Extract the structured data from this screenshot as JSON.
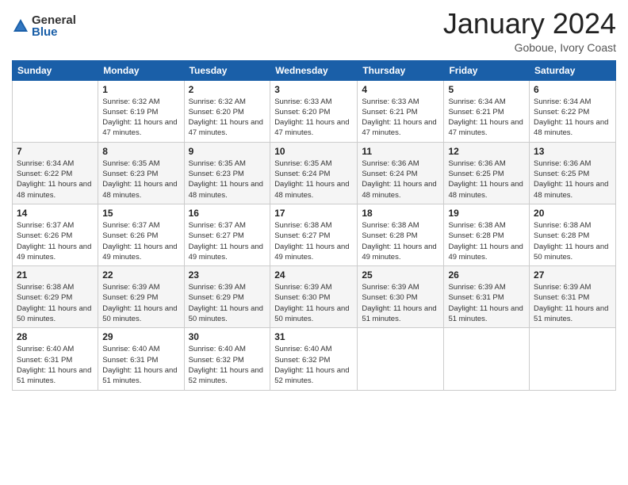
{
  "header": {
    "logo_general": "General",
    "logo_blue": "Blue",
    "month_title": "January 2024",
    "subtitle": "Goboue, Ivory Coast"
  },
  "days_of_week": [
    "Sunday",
    "Monday",
    "Tuesday",
    "Wednesday",
    "Thursday",
    "Friday",
    "Saturday"
  ],
  "weeks": [
    [
      {
        "day": "",
        "sunrise": "",
        "sunset": "",
        "daylight": ""
      },
      {
        "day": "1",
        "sunrise": "Sunrise: 6:32 AM",
        "sunset": "Sunset: 6:19 PM",
        "daylight": "Daylight: 11 hours and 47 minutes."
      },
      {
        "day": "2",
        "sunrise": "Sunrise: 6:32 AM",
        "sunset": "Sunset: 6:20 PM",
        "daylight": "Daylight: 11 hours and 47 minutes."
      },
      {
        "day": "3",
        "sunrise": "Sunrise: 6:33 AM",
        "sunset": "Sunset: 6:20 PM",
        "daylight": "Daylight: 11 hours and 47 minutes."
      },
      {
        "day": "4",
        "sunrise": "Sunrise: 6:33 AM",
        "sunset": "Sunset: 6:21 PM",
        "daylight": "Daylight: 11 hours and 47 minutes."
      },
      {
        "day": "5",
        "sunrise": "Sunrise: 6:34 AM",
        "sunset": "Sunset: 6:21 PM",
        "daylight": "Daylight: 11 hours and 47 minutes."
      },
      {
        "day": "6",
        "sunrise": "Sunrise: 6:34 AM",
        "sunset": "Sunset: 6:22 PM",
        "daylight": "Daylight: 11 hours and 48 minutes."
      }
    ],
    [
      {
        "day": "7",
        "sunrise": "Sunrise: 6:34 AM",
        "sunset": "Sunset: 6:22 PM",
        "daylight": "Daylight: 11 hours and 48 minutes."
      },
      {
        "day": "8",
        "sunrise": "Sunrise: 6:35 AM",
        "sunset": "Sunset: 6:23 PM",
        "daylight": "Daylight: 11 hours and 48 minutes."
      },
      {
        "day": "9",
        "sunrise": "Sunrise: 6:35 AM",
        "sunset": "Sunset: 6:23 PM",
        "daylight": "Daylight: 11 hours and 48 minutes."
      },
      {
        "day": "10",
        "sunrise": "Sunrise: 6:35 AM",
        "sunset": "Sunset: 6:24 PM",
        "daylight": "Daylight: 11 hours and 48 minutes."
      },
      {
        "day": "11",
        "sunrise": "Sunrise: 6:36 AM",
        "sunset": "Sunset: 6:24 PM",
        "daylight": "Daylight: 11 hours and 48 minutes."
      },
      {
        "day": "12",
        "sunrise": "Sunrise: 6:36 AM",
        "sunset": "Sunset: 6:25 PM",
        "daylight": "Daylight: 11 hours and 48 minutes."
      },
      {
        "day": "13",
        "sunrise": "Sunrise: 6:36 AM",
        "sunset": "Sunset: 6:25 PM",
        "daylight": "Daylight: 11 hours and 48 minutes."
      }
    ],
    [
      {
        "day": "14",
        "sunrise": "Sunrise: 6:37 AM",
        "sunset": "Sunset: 6:26 PM",
        "daylight": "Daylight: 11 hours and 49 minutes."
      },
      {
        "day": "15",
        "sunrise": "Sunrise: 6:37 AM",
        "sunset": "Sunset: 6:26 PM",
        "daylight": "Daylight: 11 hours and 49 minutes."
      },
      {
        "day": "16",
        "sunrise": "Sunrise: 6:37 AM",
        "sunset": "Sunset: 6:27 PM",
        "daylight": "Daylight: 11 hours and 49 minutes."
      },
      {
        "day": "17",
        "sunrise": "Sunrise: 6:38 AM",
        "sunset": "Sunset: 6:27 PM",
        "daylight": "Daylight: 11 hours and 49 minutes."
      },
      {
        "day": "18",
        "sunrise": "Sunrise: 6:38 AM",
        "sunset": "Sunset: 6:28 PM",
        "daylight": "Daylight: 11 hours and 49 minutes."
      },
      {
        "day": "19",
        "sunrise": "Sunrise: 6:38 AM",
        "sunset": "Sunset: 6:28 PM",
        "daylight": "Daylight: 11 hours and 49 minutes."
      },
      {
        "day": "20",
        "sunrise": "Sunrise: 6:38 AM",
        "sunset": "Sunset: 6:28 PM",
        "daylight": "Daylight: 11 hours and 50 minutes."
      }
    ],
    [
      {
        "day": "21",
        "sunrise": "Sunrise: 6:38 AM",
        "sunset": "Sunset: 6:29 PM",
        "daylight": "Daylight: 11 hours and 50 minutes."
      },
      {
        "day": "22",
        "sunrise": "Sunrise: 6:39 AM",
        "sunset": "Sunset: 6:29 PM",
        "daylight": "Daylight: 11 hours and 50 minutes."
      },
      {
        "day": "23",
        "sunrise": "Sunrise: 6:39 AM",
        "sunset": "Sunset: 6:29 PM",
        "daylight": "Daylight: 11 hours and 50 minutes."
      },
      {
        "day": "24",
        "sunrise": "Sunrise: 6:39 AM",
        "sunset": "Sunset: 6:30 PM",
        "daylight": "Daylight: 11 hours and 50 minutes."
      },
      {
        "day": "25",
        "sunrise": "Sunrise: 6:39 AM",
        "sunset": "Sunset: 6:30 PM",
        "daylight": "Daylight: 11 hours and 51 minutes."
      },
      {
        "day": "26",
        "sunrise": "Sunrise: 6:39 AM",
        "sunset": "Sunset: 6:31 PM",
        "daylight": "Daylight: 11 hours and 51 minutes."
      },
      {
        "day": "27",
        "sunrise": "Sunrise: 6:39 AM",
        "sunset": "Sunset: 6:31 PM",
        "daylight": "Daylight: 11 hours and 51 minutes."
      }
    ],
    [
      {
        "day": "28",
        "sunrise": "Sunrise: 6:40 AM",
        "sunset": "Sunset: 6:31 PM",
        "daylight": "Daylight: 11 hours and 51 minutes."
      },
      {
        "day": "29",
        "sunrise": "Sunrise: 6:40 AM",
        "sunset": "Sunset: 6:31 PM",
        "daylight": "Daylight: 11 hours and 51 minutes."
      },
      {
        "day": "30",
        "sunrise": "Sunrise: 6:40 AM",
        "sunset": "Sunset: 6:32 PM",
        "daylight": "Daylight: 11 hours and 52 minutes."
      },
      {
        "day": "31",
        "sunrise": "Sunrise: 6:40 AM",
        "sunset": "Sunset: 6:32 PM",
        "daylight": "Daylight: 11 hours and 52 minutes."
      },
      {
        "day": "",
        "sunrise": "",
        "sunset": "",
        "daylight": ""
      },
      {
        "day": "",
        "sunrise": "",
        "sunset": "",
        "daylight": ""
      },
      {
        "day": "",
        "sunrise": "",
        "sunset": "",
        "daylight": ""
      }
    ]
  ]
}
